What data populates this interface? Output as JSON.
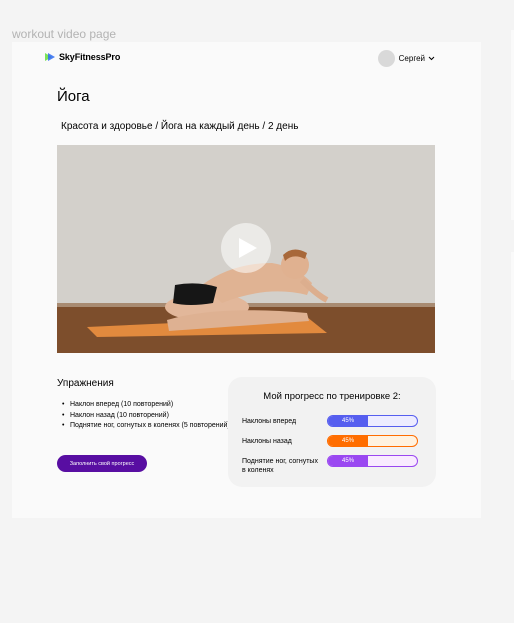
{
  "canvas": {
    "label": "workout video page"
  },
  "header": {
    "logo_text": "SkyFitnessPro",
    "user_name": "Сергей"
  },
  "page": {
    "title": "Йога",
    "breadcrumb": "Красота и здоровье / Йога на каждый день / 2 день"
  },
  "exercises": {
    "title": "Упражнения",
    "items": [
      "Наклон вперед (10 повторений)",
      "Наклон назад (10 повторений)",
      "Поднятие ног, согнутых в коленях (5 повторений)"
    ],
    "button_label": "Заполнить свой прогресс"
  },
  "progress": {
    "title": "Мой прогресс по тренировке 2:",
    "rows": [
      {
        "label": "Наклоны вперед",
        "value_text": "45%",
        "value": 45,
        "color": "#565eef",
        "bg": "#edecff"
      },
      {
        "label": "Наклоны назад",
        "value_text": "45%",
        "value": 45,
        "color": "#ff6d00",
        "bg": "#fff2e0"
      },
      {
        "label": "Поднятие ног, согнутых в коленях",
        "value_text": "45%",
        "value": 45,
        "color": "#9a48f1",
        "bg": "#f9ebff"
      }
    ]
  },
  "colors": {
    "accent": "#580ea2",
    "frame_bg": "#fafafa",
    "page_bg": "#f4f4f4"
  },
  "icons": {
    "logo": "play-triangle-logo-icon",
    "user_menu": "chevron-down-icon",
    "play": "play-icon"
  }
}
